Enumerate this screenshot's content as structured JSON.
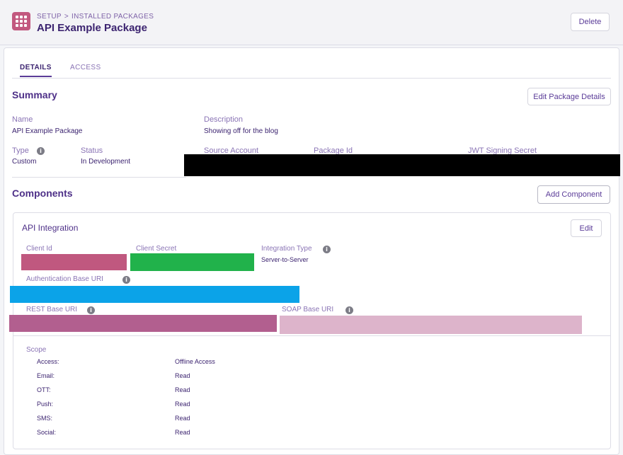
{
  "header": {
    "breadcrumb": [
      "SETUP",
      ">",
      "INSTALLED PACKAGES"
    ],
    "title": "API Example Package",
    "delete_label": "Delete",
    "app_icon": "grid-icon",
    "app_icon_color": "#c2587f"
  },
  "tabs": [
    {
      "label": "DETAILS",
      "active": true
    },
    {
      "label": "ACCESS",
      "active": false
    }
  ],
  "summary": {
    "title": "Summary",
    "edit_label": "Edit Package Details",
    "name_label": "Name",
    "name_value": "API Example Package",
    "description_label": "Description",
    "description_value": "Showing off for the blog",
    "type_label": "Type",
    "type_value": "Custom",
    "status_label": "Status",
    "status_value": "In Development",
    "source_account_label": "Source Account",
    "package_id_label": "Package Id",
    "jwt_label": "JWT Signing Secret"
  },
  "components": {
    "title": "Components",
    "add_label": "Add Component",
    "integration": {
      "title": "API Integration",
      "edit_label": "Edit",
      "client_id_label": "Client Id",
      "client_secret_label": "Client Secret",
      "integration_type_label": "Integration Type",
      "integration_type_value": "Server-to-Server",
      "auth_base_uri_label": "Authentication Base URI",
      "rest_base_uri_label": "REST Base URI",
      "soap_base_uri_label": "SOAP Base URI",
      "scope_label": "Scope",
      "scope": [
        {
          "key": "Access:",
          "value": "Offline Access"
        },
        {
          "key": "Email:",
          "value": "Read"
        },
        {
          "key": "OTT:",
          "value": "Read"
        },
        {
          "key": "Push:",
          "value": "Read"
        },
        {
          "key": "SMS:",
          "value": "Read"
        },
        {
          "key": "Social:",
          "value": "Read"
        }
      ]
    }
  },
  "colors": {
    "redact_black": "#000000",
    "redact_pink": "#c0587f",
    "redact_green": "#21b24b",
    "redact_blue": "#0ba3e8",
    "redact_mauve": "#b25f8f",
    "redact_light_pink": "#ddb4cb"
  }
}
